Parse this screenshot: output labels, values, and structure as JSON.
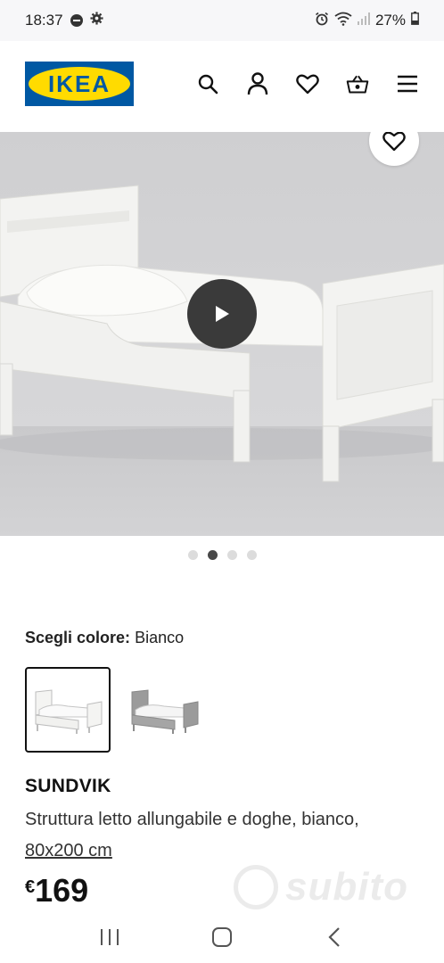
{
  "status_bar": {
    "time": "18:37",
    "battery": "27%"
  },
  "header": {
    "logo_text": "IKEA",
    "icons": [
      "search-icon",
      "account-icon",
      "heart-icon",
      "basket-icon",
      "menu-icon"
    ]
  },
  "gallery": {
    "image_count": 4,
    "active_index": 1
  },
  "product": {
    "color_label": "Scegli colore:",
    "color_value": "Bianco",
    "swatches": [
      {
        "name": "Bianco",
        "selected": true
      },
      {
        "name": "Grigio",
        "selected": false
      }
    ],
    "name": "SUNDVIK",
    "description": "Struttura letto allungabile e doghe, bianco, ",
    "size_link": "80x200 cm",
    "currency": "€",
    "price": "169"
  },
  "watermark": {
    "text": "subito"
  },
  "colors": {
    "ikea_blue": "#0058a3",
    "ikea_yellow": "#ffdb00"
  }
}
